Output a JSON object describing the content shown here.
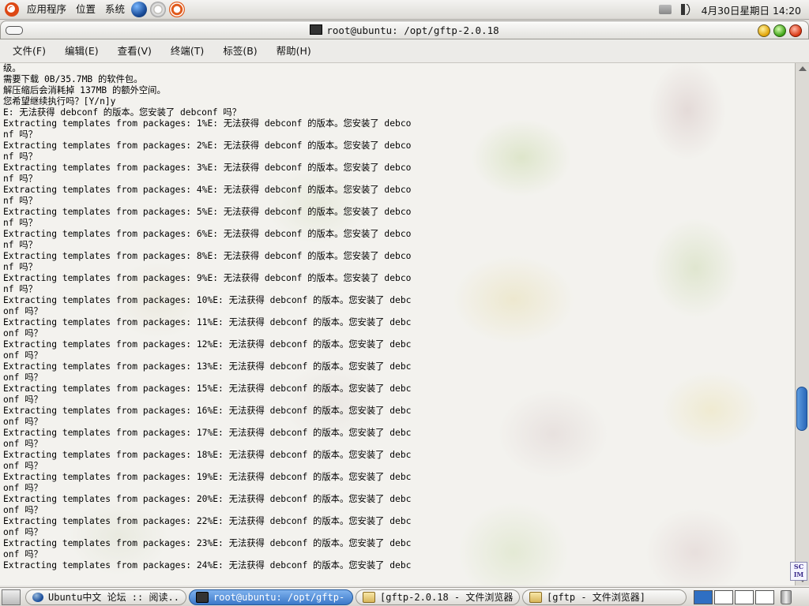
{
  "top_panel": {
    "menus": [
      "应用程序",
      "位置",
      "系统"
    ],
    "launchers": [
      "browser-icon",
      "mail-icon",
      "help-icon"
    ],
    "tray": [
      "printer-icon",
      "volume-icon"
    ],
    "clock": "4月30日星期日 14:20"
  },
  "window": {
    "title": "root@ubuntu: /opt/gftp-2.0.18",
    "menu": [
      "文件(F)",
      "编辑(E)",
      "查看(V)",
      "终端(T)",
      "标签(B)",
      "帮助(H)"
    ],
    "buttons": [
      "minimize-button",
      "maximize-button",
      "close-button"
    ]
  },
  "terminal": {
    "lines": [
      "级。",
      "需要下载 0B/35.7MB 的软件包。",
      "解压缩后会消耗掉 137MB 的额外空间。",
      "您希望继续执行吗？[Y/n]y",
      "E: 无法获得 debconf 的版本。您安装了 debconf 吗？",
      "Extracting templates from packages: 1%E: 无法获得 debconf 的版本。您安装了 debco",
      "nf 吗？",
      "Extracting templates from packages: 2%E: 无法获得 debconf 的版本。您安装了 debco",
      "nf 吗？",
      "Extracting templates from packages: 3%E: 无法获得 debconf 的版本。您安装了 debco",
      "nf 吗？",
      "Extracting templates from packages: 4%E: 无法获得 debconf 的版本。您安装了 debco",
      "nf 吗？",
      "Extracting templates from packages: 5%E: 无法获得 debconf 的版本。您安装了 debco",
      "nf 吗？",
      "Extracting templates from packages: 6%E: 无法获得 debconf 的版本。您安装了 debco",
      "nf 吗？",
      "Extracting templates from packages: 8%E: 无法获得 debconf 的版本。您安装了 debco",
      "nf 吗？",
      "Extracting templates from packages: 9%E: 无法获得 debconf 的版本。您安装了 debco",
      "nf 吗？",
      "Extracting templates from packages: 10%E: 无法获得 debconf 的版本。您安装了 debc",
      "onf 吗？",
      "Extracting templates from packages: 11%E: 无法获得 debconf 的版本。您安装了 debc",
      "onf 吗？",
      "Extracting templates from packages: 12%E: 无法获得 debconf 的版本。您安装了 debc",
      "onf 吗？",
      "Extracting templates from packages: 13%E: 无法获得 debconf 的版本。您安装了 debc",
      "onf 吗？",
      "Extracting templates from packages: 15%E: 无法获得 debconf 的版本。您安装了 debc",
      "onf 吗？",
      "Extracting templates from packages: 16%E: 无法获得 debconf 的版本。您安装了 debc",
      "onf 吗？",
      "Extracting templates from packages: 17%E: 无法获得 debconf 的版本。您安装了 debc",
      "onf 吗？",
      "Extracting templates from packages: 18%E: 无法获得 debconf 的版本。您安装了 debc",
      "onf 吗？",
      "Extracting templates from packages: 19%E: 无法获得 debconf 的版本。您安装了 debc",
      "onf 吗？",
      "Extracting templates from packages: 20%E: 无法获得 debconf 的版本。您安装了 debc",
      "onf 吗？",
      "Extracting templates from packages: 22%E: 无法获得 debconf 的版本。您安装了 debc",
      "onf 吗？",
      "Extracting templates from packages: 23%E: 无法获得 debconf 的版本。您安装了 debc",
      "onf 吗？",
      "Extracting templates from packages: 24%E: 无法获得 debconf 的版本。您安装了 debc"
    ]
  },
  "scim_icon": {
    "line1": "SC",
    "line2": "IM"
  },
  "taskbar": {
    "tasks": [
      {
        "label": "Ubuntu中文 论坛 :: 阅读...",
        "icon": "globe-icon",
        "active": false
      },
      {
        "label": "root@ubuntu: /opt/gftp-...",
        "icon": "terminal-icon",
        "active": true
      },
      {
        "label": "[gftp-2.0.18 - 文件浏览器]",
        "icon": "folder-icon",
        "active": false
      },
      {
        "label": "[gftp - 文件浏览器]",
        "icon": "folder-icon",
        "active": false
      }
    ],
    "workspaces": 4,
    "active_workspace": 0
  },
  "colors": {
    "accent": "#3b78c9",
    "panel": "#e8e6e3",
    "terminal_bg": "#f3f2ee",
    "terminal_fg": "#000000"
  }
}
